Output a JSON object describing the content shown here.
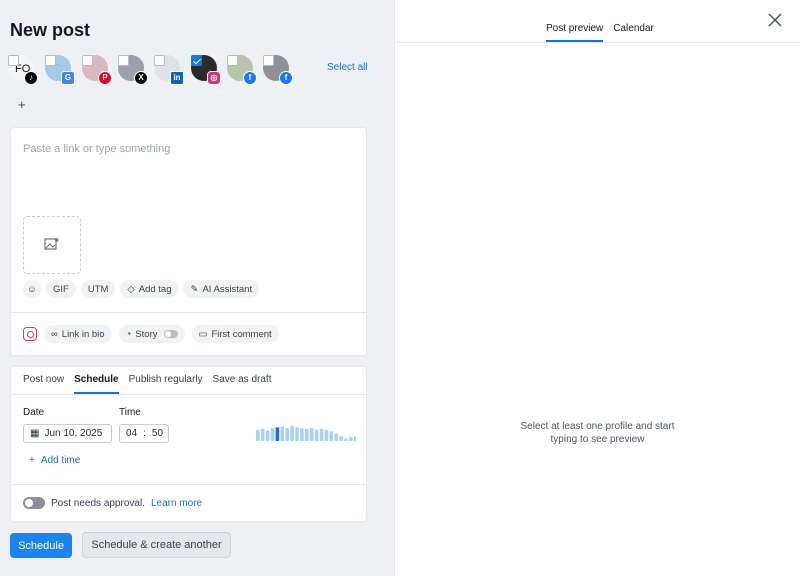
{
  "header": {
    "title": "New post"
  },
  "profiles": {
    "select_all": "Select all",
    "add": "+",
    "items": [
      {
        "initials": "FO",
        "network": "tiktok",
        "network_color": "#000000",
        "checked": false
      },
      {
        "initials": "",
        "network": "google-business",
        "network_color": "#4285f4",
        "checked": false
      },
      {
        "initials": "",
        "network": "pinterest",
        "network_color": "#e60023",
        "checked": false
      },
      {
        "initials": "",
        "network": "x",
        "network_color": "#000000",
        "checked": false
      },
      {
        "initials": "",
        "network": "linkedin",
        "network_color": "#0a66c2",
        "checked": false
      },
      {
        "initials": "",
        "network": "instagram",
        "network_color": "#d6317a",
        "checked": true
      },
      {
        "initials": "",
        "network": "facebook",
        "network_color": "#1877f2",
        "checked": false
      },
      {
        "initials": "",
        "network": "facebook",
        "network_color": "#1877f2",
        "checked": false
      }
    ]
  },
  "editor": {
    "placeholder": "Paste a link or type something",
    "tools": {
      "gif": "GIF",
      "utm": "UTM",
      "add_tag": "Add tag",
      "ai": "AI Assistant"
    },
    "instagram": {
      "link_in_bio": "Link in bio",
      "story": "Story",
      "first_comment": "First comment"
    }
  },
  "schedule": {
    "tabs": [
      "Post now",
      "Schedule",
      "Publish regularly",
      "Save as draft"
    ],
    "active_tab": "Schedule",
    "date_label": "Date",
    "date_value": "Jun 10, 2025",
    "time_label": "Time",
    "time_hour": "04",
    "time_sep": ":",
    "time_minute": "50",
    "add_time": "Add time",
    "approval_text": "Post needs approval.",
    "learn_more": "Learn more",
    "activity": [
      0.7,
      0.75,
      0.65,
      0.8,
      0.85,
      0.9,
      0.8,
      0.95,
      0.85,
      0.8,
      0.75,
      0.8,
      0.7,
      0.75,
      0.7,
      0.6,
      0.45,
      0.3,
      0.15,
      0.25,
      0.3,
      0.6
    ]
  },
  "actions": {
    "primary": "Schedule",
    "secondary": "Schedule & create another"
  },
  "preview": {
    "tabs": [
      "Post preview",
      "Calendar"
    ],
    "active_tab": "Post preview",
    "empty_text": "Select at least one profile and start typing to see preview"
  },
  "colors": {
    "accent": "#1672d9",
    "primary_button": "#1a84f0"
  }
}
